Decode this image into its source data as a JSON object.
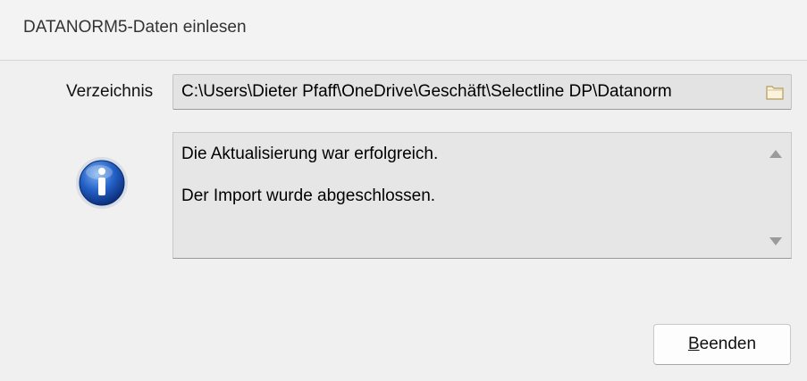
{
  "window": {
    "title": "DATANORM5-Daten einlesen"
  },
  "directory": {
    "label": "Verzeichnis",
    "value": "C:\\Users\\Dieter Pfaff\\OneDrive\\Geschäft\\Selectline DP\\Datanorm"
  },
  "message": {
    "icon": "info-icon",
    "lines": [
      "Die Aktualisierung war erfolgreich.",
      "Der Import wurde abgeschlossen."
    ]
  },
  "buttons": {
    "close_accel": "B",
    "close_rest": "eenden"
  },
  "colors": {
    "window_bg": "#f0f0f0",
    "field_bg": "#e3e3e3",
    "info_blue": "#1d52b4"
  }
}
